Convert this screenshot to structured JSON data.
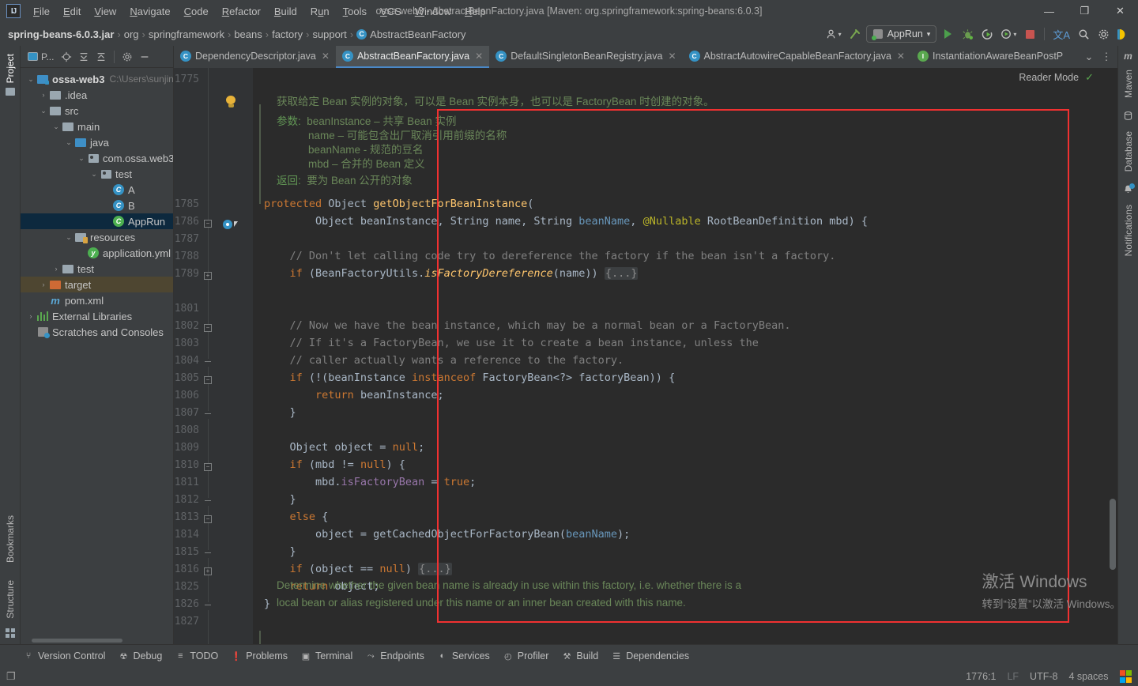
{
  "window": {
    "title": "ossa-web3 - AbstractBeanFactory.java [Maven: org.springframework:spring-beans:6.0.3]",
    "minimize": "—",
    "maximize": "❐",
    "close": "✕",
    "logo": "IJ"
  },
  "menu": [
    "File",
    "Edit",
    "View",
    "Navigate",
    "Code",
    "Refactor",
    "Build",
    "Run",
    "Tools",
    "VCS",
    "Window",
    "Help"
  ],
  "breadcrumb": {
    "items": [
      "spring-beans-6.0.3.jar",
      "org",
      "springframework",
      "beans",
      "factory",
      "support"
    ],
    "separator": "›",
    "last": "AbstractBeanFactory",
    "last_icon": "C"
  },
  "nav_toolbar": {
    "profiler_dropdown": "▾",
    "run_config": "AppRun",
    "run_config_caret": "▾",
    "run": "run-button",
    "debug": "debug-button",
    "run_coverage": "run-with-coverage",
    "profile": "profile-button",
    "stop": "stop-button",
    "translate": "文A",
    "search": "⌕",
    "settings": "⚙"
  },
  "left_strip": {
    "project": "Project",
    "bookmarks": "Bookmarks",
    "structure": "Structure"
  },
  "right_strip": {
    "maven": "Maven",
    "database": "Database",
    "notifications": "Notifications"
  },
  "project_panel": {
    "title": "P...",
    "tools": [
      "locate-icon",
      "expand-all-icon",
      "collapse-all-icon",
      "gear-icon",
      "hide-icon"
    ],
    "tree": [
      {
        "depth": 0,
        "arrow": "⌄",
        "icon": "module",
        "label": "ossa-web3",
        "bold": true,
        "path": "C:\\Users\\sunjinx",
        "state": "none"
      },
      {
        "depth": 1,
        "arrow": "›",
        "icon": "folder",
        "label": ".idea",
        "bold": false,
        "path": "",
        "state": "none"
      },
      {
        "depth": 1,
        "arrow": "⌄",
        "icon": "folder",
        "label": "src",
        "bold": false,
        "path": "",
        "state": "none"
      },
      {
        "depth": 2,
        "arrow": "⌄",
        "icon": "folder",
        "label": "main",
        "bold": false,
        "path": "",
        "state": "none"
      },
      {
        "depth": 3,
        "arrow": "⌄",
        "icon": "source",
        "label": "java",
        "bold": false,
        "path": "",
        "state": "none"
      },
      {
        "depth": 4,
        "arrow": "⌄",
        "icon": "package",
        "label": "com.ossa.web3",
        "bold": false,
        "path": "",
        "state": "none"
      },
      {
        "depth": 5,
        "arrow": "⌄",
        "icon": "package",
        "label": "test",
        "bold": false,
        "path": "",
        "state": "none"
      },
      {
        "depth": 6,
        "arrow": "",
        "icon": "class",
        "label": "A",
        "bold": false,
        "path": "",
        "state": "none"
      },
      {
        "depth": 6,
        "arrow": "",
        "icon": "class",
        "label": "B",
        "bold": false,
        "path": "",
        "state": "none"
      },
      {
        "depth": 6,
        "arrow": "",
        "icon": "runclass",
        "label": "AppRun",
        "bold": false,
        "path": "",
        "state": "selected"
      },
      {
        "depth": 3,
        "arrow": "⌄",
        "icon": "resources",
        "label": "resources",
        "bold": false,
        "path": "",
        "state": "none"
      },
      {
        "depth": 4,
        "arrow": "",
        "icon": "yml",
        "label": "application.yml",
        "bold": false,
        "path": "",
        "state": "none"
      },
      {
        "depth": 2,
        "arrow": "›",
        "icon": "folder",
        "label": "test",
        "bold": false,
        "path": "",
        "state": "none"
      },
      {
        "depth": 1,
        "arrow": "›",
        "icon": "target",
        "label": "target",
        "bold": false,
        "path": "",
        "state": "amber"
      },
      {
        "depth": 1,
        "arrow": "",
        "icon": "maven",
        "label": "pom.xml",
        "bold": false,
        "path": "",
        "state": "none"
      },
      {
        "depth": 0,
        "arrow": "›",
        "icon": "libs",
        "label": "External Libraries",
        "bold": false,
        "path": "",
        "state": "none"
      },
      {
        "depth": 0,
        "arrow": "",
        "icon": "scratch",
        "label": "Scratches and Consoles",
        "bold": false,
        "path": "",
        "state": "none"
      }
    ]
  },
  "editor_tabs": [
    {
      "label": "DependencyDescriptor.java",
      "icon": "C",
      "type": "class",
      "active": false
    },
    {
      "label": "AbstractBeanFactory.java",
      "icon": "C",
      "type": "abstract-class",
      "active": true
    },
    {
      "label": "DefaultSingletonBeanRegistry.java",
      "icon": "C",
      "type": "class",
      "active": false
    },
    {
      "label": "AbstractAutowireCapableBeanFactory.java",
      "icon": "C",
      "type": "abstract-class",
      "active": false
    },
    {
      "label": "InstantiationAwareBeanPostP",
      "icon": "I",
      "type": "interface",
      "active": false
    }
  ],
  "editor_tabs_overflow": "⌄",
  "editor_tabs_more": "⋮",
  "reader_mode": {
    "label": "Reader Mode",
    "check": "✓"
  },
  "editor": {
    "line_numbers": [
      "1775",
      "1785",
      "1786",
      "1787",
      "1788",
      "1789",
      "1801",
      "1802",
      "1803",
      "1804",
      "1805",
      "1806",
      "1807",
      "1808",
      "1809",
      "1810",
      "1811",
      "1812",
      "1813",
      "1814",
      "1815",
      "1816",
      "1825",
      "1826",
      "1827"
    ],
    "javadoc": {
      "summary": "获取给定 Bean 实例的对象，可以是 Bean 实例本身，也可以是 FactoryBean 时创建的对象。",
      "params_label": "参数:",
      "params": [
        "beanInstance – 共享 Bean 实例",
        "name – 可能包含出厂取消引用前缀的名称",
        "beanName - 规范的豆名",
        "mbd – 合并的 Bean 定义"
      ],
      "returns_label": "返回:",
      "returns": "要为 Bean 公开的对象"
    },
    "code_lines": [
      "protected Object getObjectForBeanInstance(",
      "        Object beanInstance, String name, String beanName, @Nullable RootBeanDefinition mbd) {",
      "",
      "    // Don't let calling code try to dereference the factory if the bean isn't a factory.",
      "    if (BeanFactoryUtils.isFactoryDereference(name)) {...}",
      "",
      "    // Now we have the bean instance, which may be a normal bean or a FactoryBean.",
      "    // If it's a FactoryBean, we use it to create a bean instance, unless the",
      "    // caller actually wants a reference to the factory.",
      "    if (!(beanInstance instanceof FactoryBean<?> factoryBean)) {",
      "        return beanInstance;",
      "    }",
      "",
      "    Object object = null;",
      "    if (mbd != null) {",
      "        mbd.isFactoryBean = true;",
      "    }",
      "    else {",
      "        object = getCachedObjectForFactoryBean(beanName);",
      "    }",
      "    if (object == null) {...}",
      "    return object;",
      "}"
    ],
    "next_doc": [
      "Determine whether the given bean name is already in use within this factory, i.e. whether there is a",
      "local bean or alias registered under this name or an inner bean created with this name."
    ]
  },
  "watermark": {
    "line1": "激活 Windows",
    "line2": "转到“设置”以激活 Windows。"
  },
  "bottom_tools": [
    {
      "label": "Version Control",
      "icon": "⑂"
    },
    {
      "label": "Debug",
      "icon": "☢"
    },
    {
      "label": "TODO",
      "icon": "≡"
    },
    {
      "label": "Problems",
      "icon": "❗"
    },
    {
      "label": "Terminal",
      "icon": "▣"
    },
    {
      "label": "Endpoints",
      "icon": "⤳"
    },
    {
      "label": "Services",
      "icon": "◐"
    },
    {
      "label": "Profiler",
      "icon": "◴"
    },
    {
      "label": "Build",
      "icon": "⚒"
    },
    {
      "label": "Dependencies",
      "icon": "☰"
    }
  ],
  "statusbar": {
    "left_icon": "❐",
    "caret_position": "1776:1",
    "line_separator": "LF",
    "encoding": "UTF-8",
    "indent": "4 spaces",
    "os_logo": "windows-logo"
  },
  "colors": {
    "accent": "#3592c4",
    "selection": "#0d293e",
    "highlight_box": "#f03131",
    "run_green": "#4c9f4c",
    "stop_red": "#c75450",
    "editor_bg": "#2b2b2b",
    "panel_bg": "#3c3f41"
  }
}
